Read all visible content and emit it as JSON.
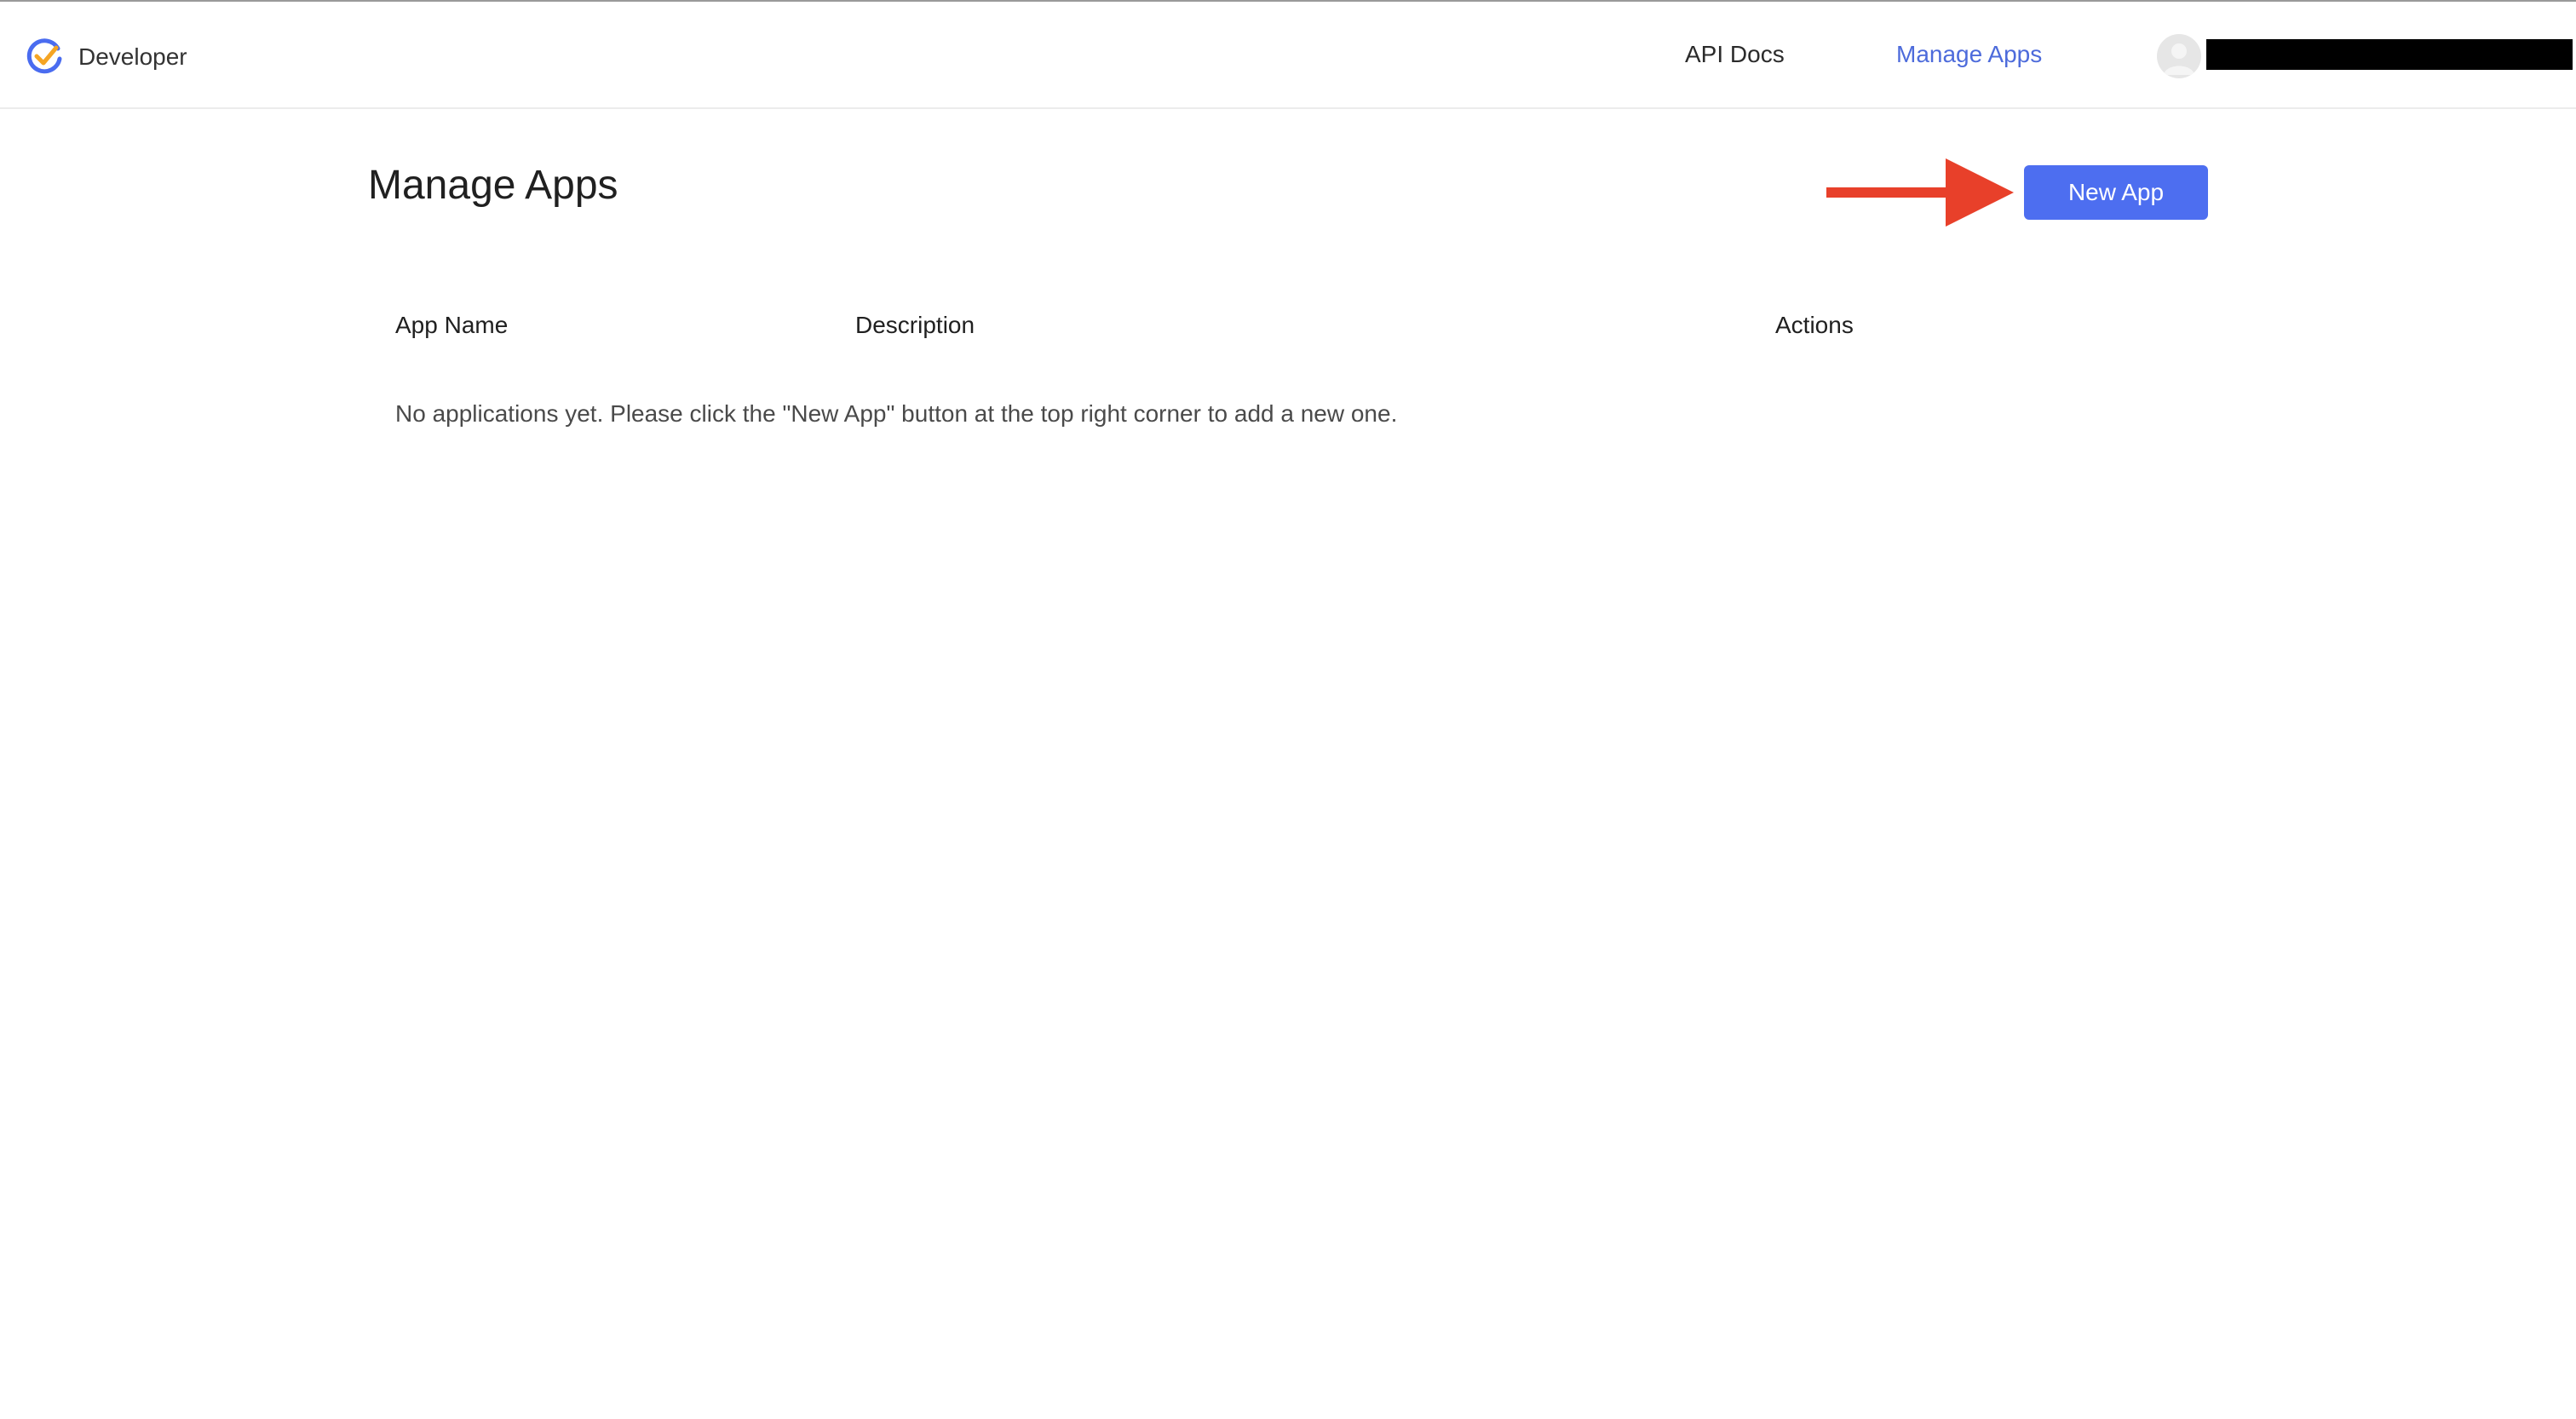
{
  "header": {
    "brand_label": "Developer",
    "nav": {
      "api_docs": "API Docs",
      "manage_apps": "Manage Apps"
    },
    "logo_icon": "checkmark-circle-icon",
    "avatar_icon": "user-avatar-icon"
  },
  "main": {
    "title": "Manage Apps",
    "new_app_label": "New App",
    "table": {
      "columns": [
        "App Name",
        "Description",
        "Actions"
      ],
      "rows": [],
      "empty_message": "No applications yet. Please click the \"New App\" button at the top right corner to add a new one."
    }
  },
  "colors": {
    "accent": "#4d6ef0",
    "active_link": "#4d6bdb",
    "annotation_arrow": "#e8402a",
    "logo_blue": "#4a6cf0",
    "logo_orange": "#f5a524"
  }
}
